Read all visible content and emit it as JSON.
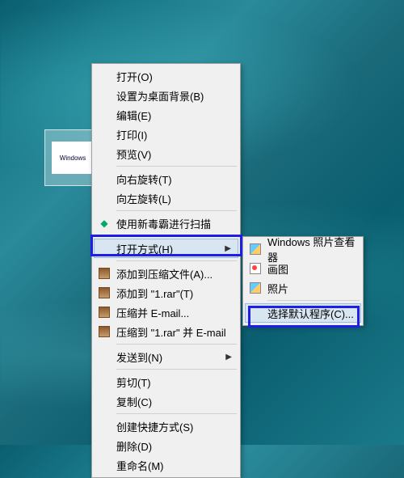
{
  "desktop": {
    "selected_file_label": "Windows"
  },
  "menu": {
    "open": "打开(O)",
    "set_wallpaper": "设置为桌面背景(B)",
    "edit": "编辑(E)",
    "print": "打印(I)",
    "preview": "预览(V)",
    "rotate_right": "向右旋转(T)",
    "rotate_left": "向左旋转(L)",
    "scan": "使用新毒霸进行扫描",
    "open_with": "打开方式(H)",
    "add_to_archive": "添加到压缩文件(A)...",
    "add_to_rar": "添加到 \"1.rar\"(T)",
    "compress_email": "压缩并 E-mail...",
    "compress_rar_email": "压缩到 \"1.rar\" 并 E-mail",
    "send_to": "发送到(N)",
    "cut": "剪切(T)",
    "copy": "复制(C)",
    "create_shortcut": "创建快捷方式(S)",
    "delete": "删除(D)",
    "rename": "重命名(M)"
  },
  "submenu": {
    "photo_viewer": "Windows 照片查看器",
    "paint": "画图",
    "photos": "照片",
    "choose_default": "选择默认程序(C)..."
  }
}
